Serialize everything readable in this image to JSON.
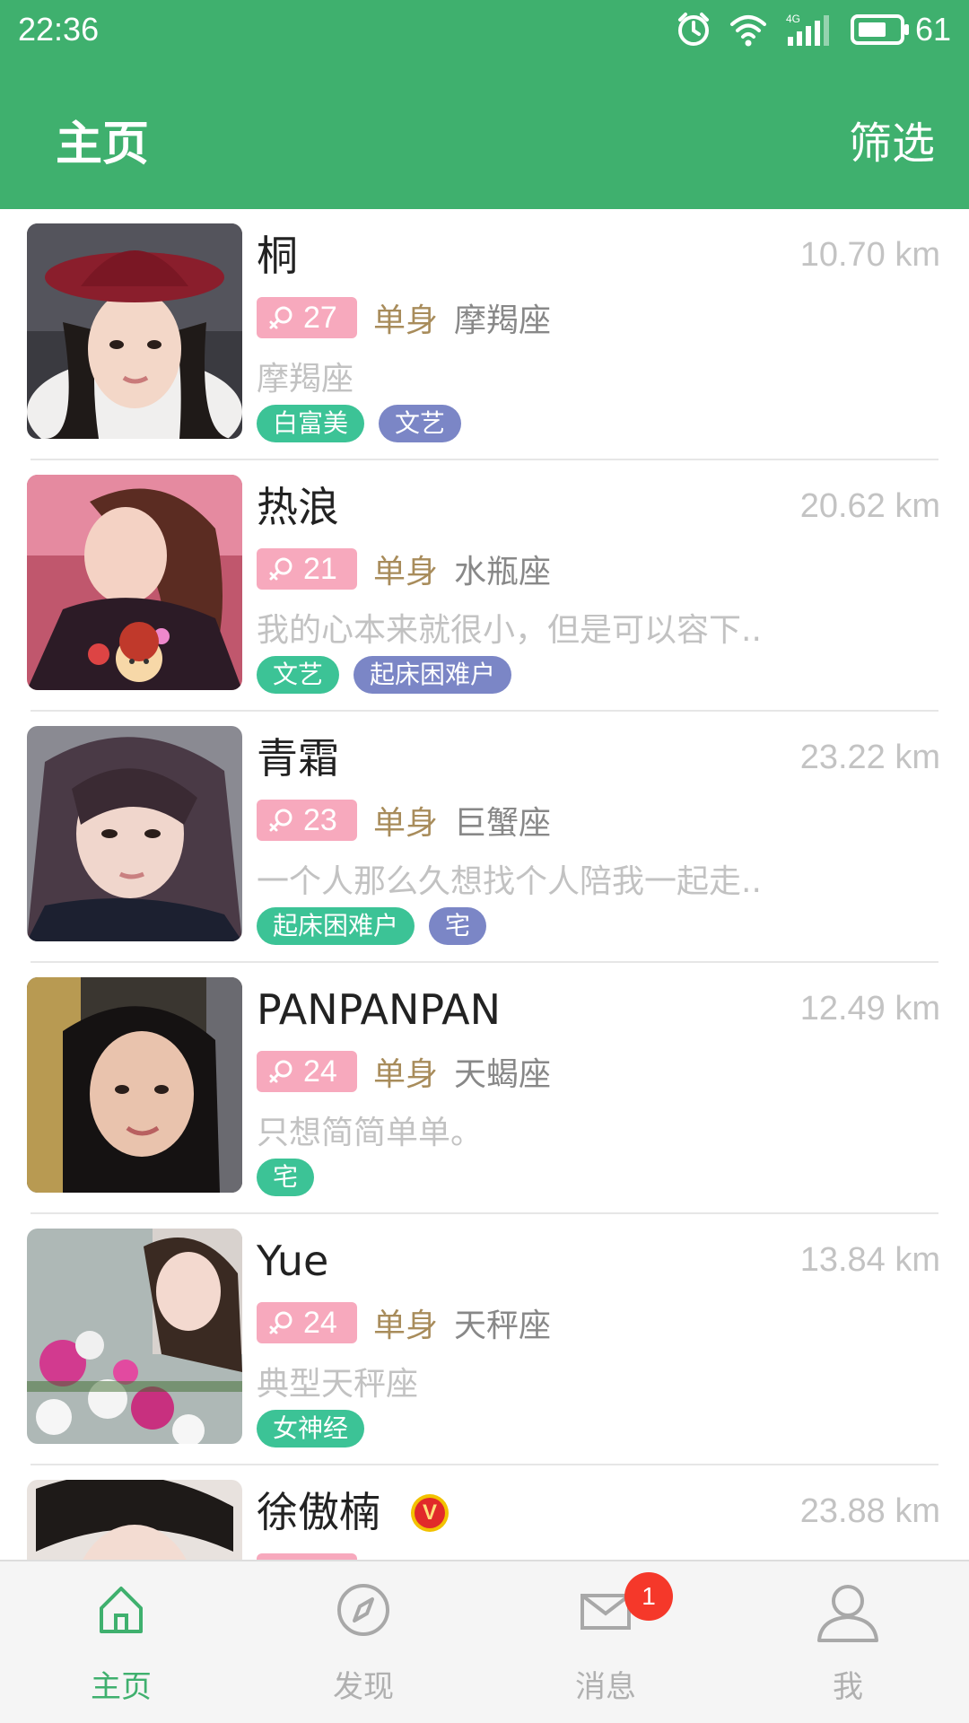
{
  "status_bar": {
    "time": "22:36",
    "battery": "61"
  },
  "header": {
    "title": "主页",
    "filter_label": "筛选"
  },
  "colors": {
    "brand_green": "#3fb06e",
    "tag_green": "#3cc396",
    "tag_purple": "#7b86c6",
    "age_pink": "#f7a9bd",
    "badge_red": "#f5382a"
  },
  "users": [
    {
      "name": "桐",
      "distance": "10.70 km",
      "age": "27",
      "status": "单身",
      "zodiac": "摩羯座",
      "bio": "摩羯座",
      "tags": [
        "白富美",
        "文艺"
      ]
    },
    {
      "name": "热浪",
      "distance": "20.62 km",
      "age": "21",
      "status": "单身",
      "zodiac": "水瓶座",
      "bio": "我的心本来就很小，但是可以容下..",
      "tags": [
        "文艺",
        "起床困难户"
      ]
    },
    {
      "name": "青霜",
      "distance": "23.22 km",
      "age": "23",
      "status": "单身",
      "zodiac": "巨蟹座",
      "bio": "一个人那么久想找个人陪我一起走..",
      "tags": [
        "起床困难户",
        "宅"
      ]
    },
    {
      "name": "PANPANPAN",
      "distance": "12.49 km",
      "age": "24",
      "status": "单身",
      "zodiac": "天蝎座",
      "bio": "只想简简单单。",
      "tags": [
        "宅"
      ]
    },
    {
      "name": "Yue",
      "distance": "13.84 km",
      "age": "24",
      "status": "单身",
      "zodiac": "天秤座",
      "bio": "典型天秤座",
      "tags": [
        "女神经"
      ]
    },
    {
      "name": "徐傲楠",
      "distance": "23.88 km",
      "vip": "V"
    }
  ],
  "nav": {
    "home": "主页",
    "discover": "发现",
    "messages": "消息",
    "messages_badge": "1",
    "me": "我"
  }
}
